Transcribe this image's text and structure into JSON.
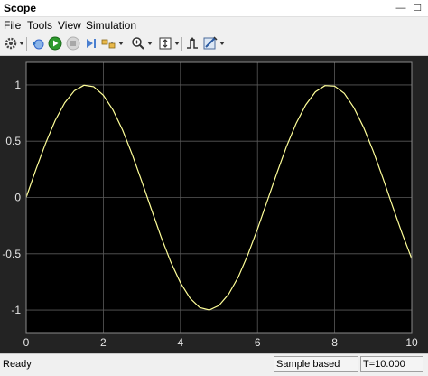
{
  "window": {
    "title": "Scope",
    "minimize": "—",
    "maximize": "☐"
  },
  "menu": {
    "items": [
      "File",
      "Tools",
      "View",
      "Simulation"
    ]
  },
  "toolbar": {
    "icons": [
      "gear-icon",
      "open-config-icon",
      "run-icon",
      "stop-icon",
      "step-forward-icon",
      "highlight-block-icon",
      "zoom-in-icon",
      "autoscale-icon",
      "triggers-icon",
      "measurements-icon"
    ]
  },
  "chart_data": {
    "type": "line",
    "x": [
      0,
      0.25,
      0.5,
      0.75,
      1,
      1.25,
      1.5,
      1.75,
      2,
      2.25,
      2.5,
      2.75,
      3,
      3.25,
      3.5,
      3.75,
      4,
      4.25,
      4.5,
      4.75,
      5,
      5.25,
      5.5,
      5.75,
      6,
      6.25,
      6.5,
      6.75,
      7,
      7.25,
      7.5,
      7.75,
      8,
      8.25,
      8.5,
      8.75,
      9,
      9.25,
      9.5,
      9.75,
      10
    ],
    "y": [
      0,
      0.247,
      0.479,
      0.682,
      0.841,
      0.949,
      0.997,
      0.984,
      0.909,
      0.778,
      0.598,
      0.382,
      0.141,
      -0.108,
      -0.351,
      -0.572,
      -0.757,
      -0.895,
      -0.978,
      -0.999,
      -0.959,
      -0.859,
      -0.706,
      -0.508,
      -0.279,
      -0.033,
      0.215,
      0.451,
      0.657,
      0.823,
      0.938,
      0.994,
      0.989,
      0.925,
      0.798,
      0.624,
      0.412,
      0.174,
      -0.075,
      -0.319,
      -0.544
    ],
    "xlim": [
      0,
      10
    ],
    "ylim": [
      -1.2,
      1.2
    ],
    "xticks": [
      "0",
      "2",
      "4",
      "6",
      "8",
      "10"
    ],
    "yticks": [
      "1",
      "0.5",
      "0",
      "-0.5",
      "-1"
    ],
    "grid": true,
    "line_color": "#ffff99",
    "background": "#000000"
  },
  "status": {
    "ready": "Ready",
    "mode": "Sample based",
    "time": "T=10.000"
  }
}
